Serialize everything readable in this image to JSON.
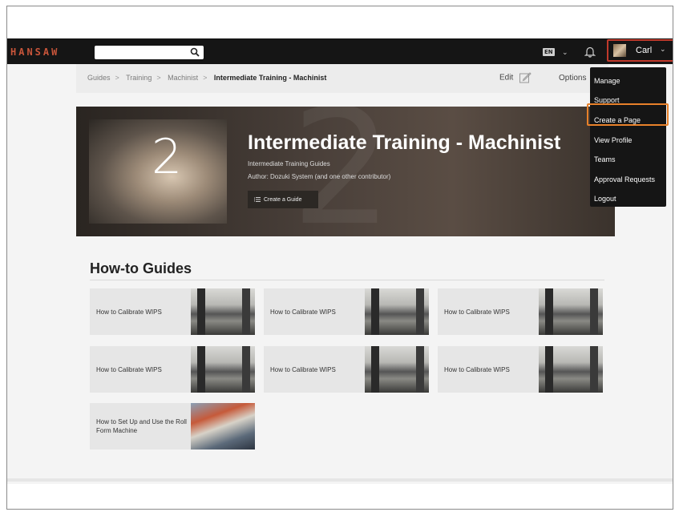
{
  "header": {
    "logo": "HANSAW",
    "search": {
      "value": "",
      "placeholder": ""
    },
    "language": "EN",
    "user_name": "Carl"
  },
  "breadcrumb": {
    "items": [
      "Guides",
      "Training",
      "Machinist"
    ],
    "current": "Intermediate Training - Machinist",
    "edit_label": "Edit",
    "options_label": "Options"
  },
  "hero": {
    "thumb_number": "2",
    "title": "Intermediate Training - Machinist",
    "subtitle": "Intermediate Training Guides",
    "author": "Author: Dozuki System (and one other contributor)",
    "create_guide_label": "Create a Guide"
  },
  "guides": {
    "title": "How-to Guides",
    "cards": [
      {
        "label": "How to Calibrate WIPS"
      },
      {
        "label": "How to Calibrate WIPS"
      },
      {
        "label": "How to Calibrate WIPS"
      },
      {
        "label": "How to Calibrate WIPS"
      },
      {
        "label": "How to Calibrate WIPS"
      },
      {
        "label": "How to Calibrate WIPS"
      },
      {
        "label": "How to Set Up and Use the Roll Form Machine"
      }
    ]
  },
  "user_menu": {
    "items": [
      "Manage",
      "Support",
      "Create a Page",
      "View Profile",
      "Teams",
      "Approval Requests",
      "Logout"
    ],
    "highlighted": "Create a Page"
  },
  "colors": {
    "topbar": "#151515",
    "logo": "#c8553a",
    "user_highlight": "#c0392b",
    "menu_highlight": "#e8812a"
  }
}
